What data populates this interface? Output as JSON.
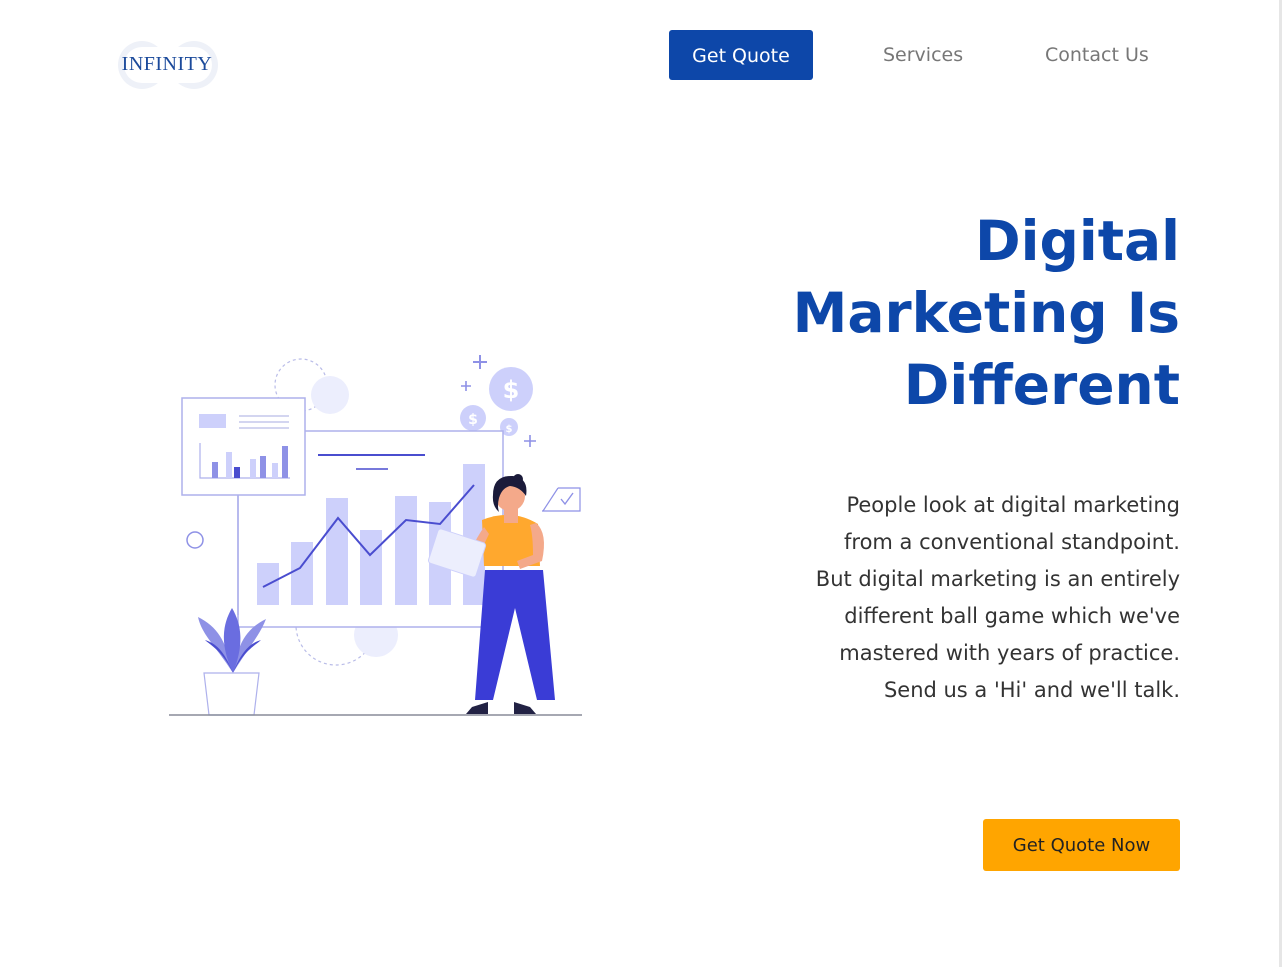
{
  "header": {
    "logo_text": "INFINITY",
    "nav": {
      "get_quote_label": "Get Quote",
      "services_label": "Services",
      "contact_label": "Contact Us"
    }
  },
  "hero": {
    "title": "Digital\nMarketing Is\nDifferent",
    "description": "People look at digital marketing\nfrom a conventional standpoint.\nBut digital marketing is an entirely\ndifferent ball game which we've\nmastered with years of practice.\nSend us a 'Hi' and we'll talk.",
    "cta_label": "Get Quote Now"
  },
  "colors": {
    "brand_blue": "#0d47a9",
    "accent_orange": "#ffa500",
    "illustration_lavender": "#cdd0fb",
    "illustration_indigo": "#3a3cd6"
  },
  "icons": {
    "illustration": "analytics-illustration",
    "logo": "infinity-logo"
  }
}
